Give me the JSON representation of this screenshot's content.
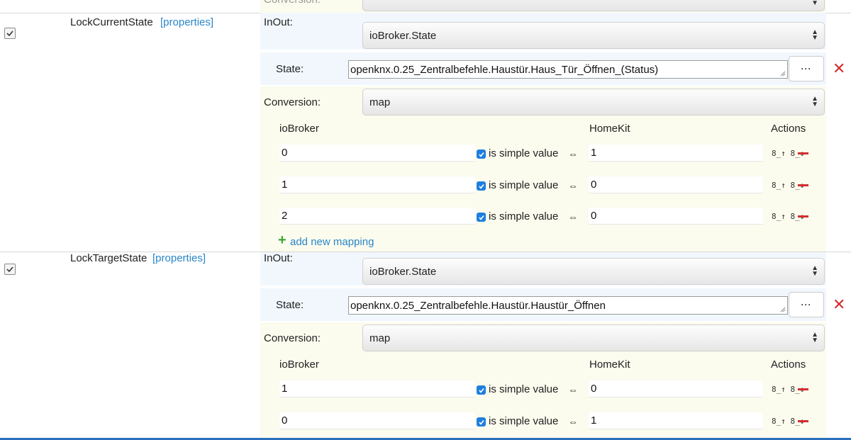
{
  "top_partial": {
    "conversion_label": "Conversion:"
  },
  "characteristics": [
    {
      "name": "LockCurrentState",
      "properties_link": "[properties]",
      "inout_label": "InOut:",
      "inout_value": "ioBroker.State",
      "state_label": "State:",
      "state_value": "openknx.0.25_Zentralbefehle.Haustür.Haus_Tür_Öffnen_(Status)",
      "conversion_label": "Conversion:",
      "conversion_value": "map",
      "map_headers": {
        "iobroker": "ioBroker",
        "homekit": "HomeKit",
        "actions": "Actions"
      },
      "mappings": [
        {
          "iobroker": "0",
          "simple": "is simple value",
          "homekit": "1"
        },
        {
          "iobroker": "1",
          "simple": "is simple value",
          "homekit": "0"
        },
        {
          "iobroker": "2",
          "simple": "is simple value",
          "homekit": "0"
        }
      ],
      "add_mapping": "add new mapping"
    },
    {
      "name": "LockTargetState",
      "properties_link": "[properties]",
      "inout_label": "InOut:",
      "inout_value": "ioBroker.State",
      "state_label": "State:",
      "state_value": "openknx.0.25_Zentralbefehle.Haustür.Haustür_Öffnen",
      "conversion_label": "Conversion:",
      "conversion_value": "map",
      "map_headers": {
        "iobroker": "ioBroker",
        "homekit": "HomeKit",
        "actions": "Actions"
      },
      "mappings": [
        {
          "iobroker": "1",
          "simple": "is simple value",
          "homekit": "0"
        },
        {
          "iobroker": "0",
          "simple": "is simple value",
          "homekit": "1"
        }
      ]
    }
  ],
  "icons": {
    "dots": "···",
    "delete": "✕",
    "swap": "⇔",
    "sort": "⇅",
    "plus": "+"
  },
  "colors": {
    "link": "#2a86c9",
    "delete": "#d42e2e",
    "add": "#3fa534",
    "checkbox": "#1f7fe0",
    "inout_bg": "#f1f7fd",
    "conversion_bg": "#fbfbee"
  }
}
